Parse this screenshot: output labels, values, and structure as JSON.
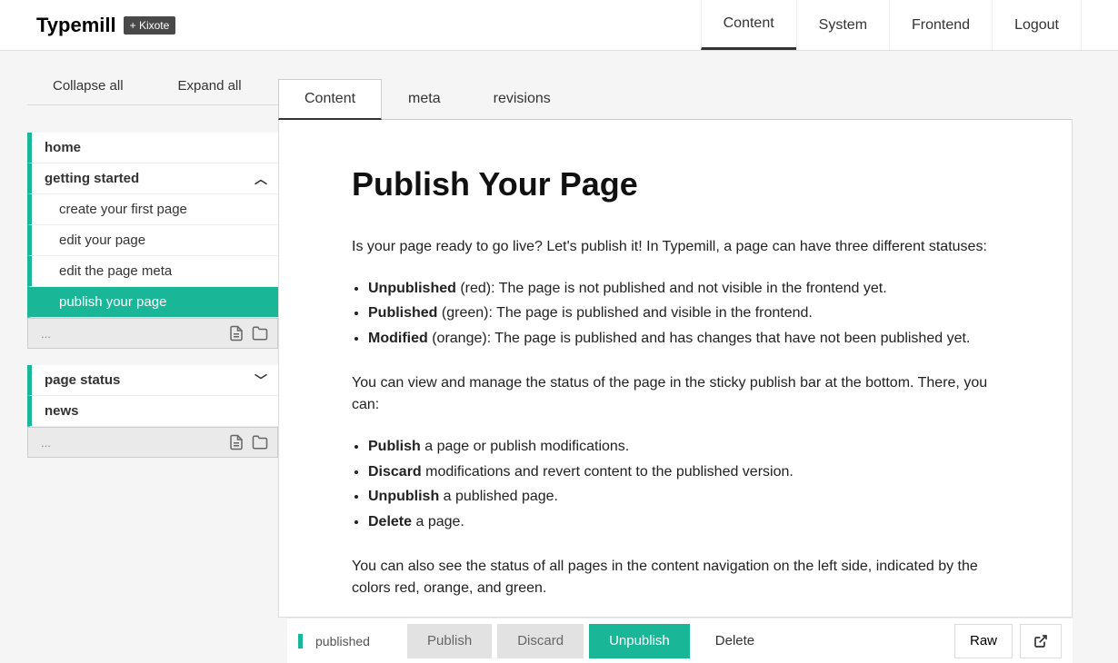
{
  "brand": {
    "name": "Typemill",
    "badge": "+ Kixote"
  },
  "topnav": {
    "content": "Content",
    "system": "System",
    "frontend": "Frontend",
    "logout": "Logout"
  },
  "sidebar": {
    "collapse": "Collapse all",
    "expand": "Expand all",
    "items": [
      {
        "label": "home",
        "bold": true
      },
      {
        "label": "getting started",
        "bold": true,
        "chevron": "up"
      },
      {
        "label": "create your first page",
        "child": true
      },
      {
        "label": "edit your page",
        "child": true
      },
      {
        "label": "edit the page meta",
        "child": true
      },
      {
        "label": "publish your page",
        "child": true,
        "active": true
      }
    ],
    "new_placeholder": "...",
    "items2": [
      {
        "label": "page status",
        "bold": true,
        "chevron": "down"
      },
      {
        "label": "news",
        "bold": true
      }
    ]
  },
  "tabs": {
    "content": "Content",
    "meta": "meta",
    "revisions": "revisions"
  },
  "page": {
    "title": "Publish Your Page",
    "intro": "Is your page ready to go live? Let's publish it! In Typemill, a page can have three different statuses:",
    "statuses": [
      {
        "name": "Unpublished",
        "color_word": "(red)",
        "desc": ": The page is not published and not visible in the frontend yet."
      },
      {
        "name": "Published",
        "color_word": "(green)",
        "desc": ": The page is published and visible in the frontend."
      },
      {
        "name": "Modified",
        "color_word": "(orange)",
        "desc": ": The page is published and has changes that have not been published yet."
      }
    ],
    "para2": "You can view and manage the status of the page in the sticky publish bar at the bottom. There, you can:",
    "actions": [
      {
        "name": "Publish",
        "desc": " a page or publish modifications."
      },
      {
        "name": "Discard",
        "desc": " modifications and revert content to the published version."
      },
      {
        "name": "Unpublish",
        "desc": " a published page."
      },
      {
        "name": "Delete",
        "desc": " a page."
      }
    ],
    "para3": "You can also see the status of all pages in the content navigation on the left side, indicated by the colors red, orange, and green."
  },
  "publishbar": {
    "status": "published",
    "publish": "Publish",
    "discard": "Discard",
    "unpublish": "Unpublish",
    "delete": "Delete",
    "raw": "Raw"
  }
}
